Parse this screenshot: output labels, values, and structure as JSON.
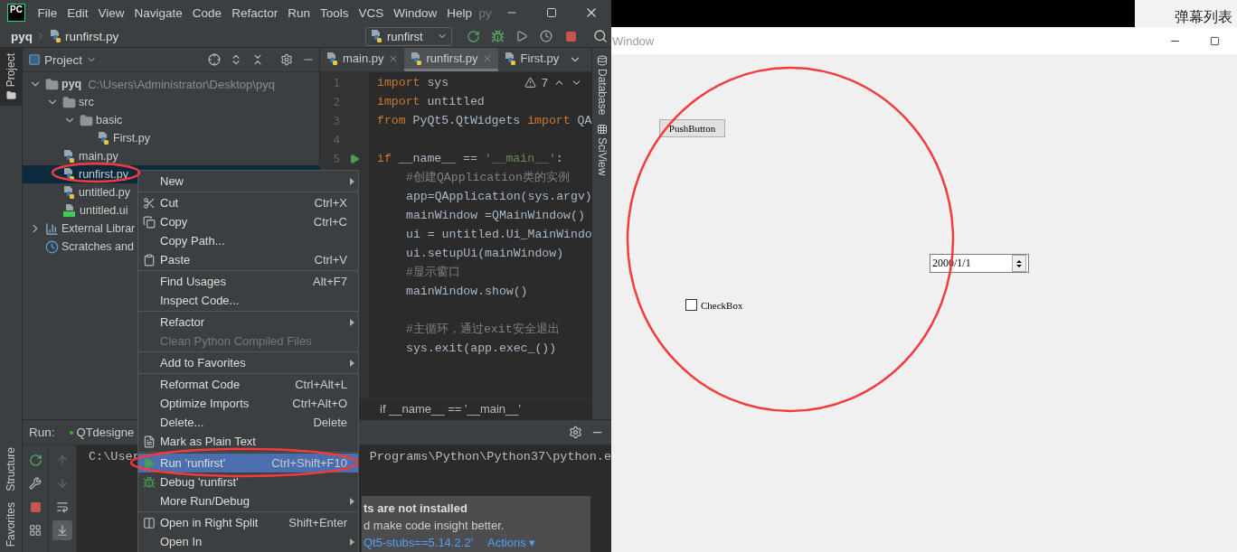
{
  "menubar": {
    "logo": "PC",
    "items": [
      "File",
      "Edit",
      "View",
      "Navigate",
      "Code",
      "Refactor",
      "Run",
      "Tools",
      "VCS",
      "Window",
      "Help"
    ],
    "title_fragment": "py"
  },
  "navbar": {
    "project": "pyq",
    "file": "runfirst.py",
    "run_config": "runfirst"
  },
  "left_stripe": {
    "top": [
      {
        "label": "Project",
        "selected": true
      }
    ],
    "bottom": [
      {
        "label": "Structure",
        "selected": false
      },
      {
        "label": "Favorites",
        "selected": false
      }
    ]
  },
  "project_panel": {
    "title": "Project",
    "tree": [
      {
        "kind": "folder",
        "label": "pyq",
        "path": "C:\\Users\\Administrator\\Desktop\\pyq",
        "expanded": true,
        "selected": false,
        "children": [
          {
            "kind": "folder",
            "label": "src",
            "expanded": true,
            "selected": false,
            "children": [
              {
                "kind": "folder",
                "label": "basic",
                "expanded": true,
                "selected": false,
                "children": [
                  {
                    "kind": "python",
                    "label": "First.py",
                    "selected": false
                  }
                ]
              }
            ]
          },
          {
            "kind": "python",
            "label": "main.py",
            "selected": false
          },
          {
            "kind": "python",
            "label": "runfirst.py",
            "selected": true
          },
          {
            "kind": "python",
            "label": "untitled.py",
            "selected": false
          },
          {
            "kind": "ui",
            "label": "untitled.ui",
            "selected": false
          }
        ]
      },
      {
        "kind": "library",
        "label": "External Librar",
        "expanded": false,
        "selected": false
      },
      {
        "kind": "scratches",
        "label": "Scratches and",
        "selected": false
      }
    ]
  },
  "editor": {
    "tabs": [
      {
        "label": "main.py",
        "selected": false,
        "closable": true
      },
      {
        "label": "runfirst.py",
        "selected": true,
        "closable": true
      },
      {
        "label": "First.py",
        "selected": false,
        "closable": false
      }
    ],
    "warning_count": "7",
    "lines": [
      {
        "kind": "code",
        "number": "1",
        "runnable": false,
        "indented": false,
        "tokens": [
          {
            "kind": "keyword",
            "text": "import"
          },
          {
            "kind": "plain",
            "text": " sys"
          }
        ]
      },
      {
        "kind": "code",
        "number": "2",
        "runnable": false,
        "indented": false,
        "tokens": [
          {
            "kind": "keyword",
            "text": "import"
          },
          {
            "kind": "plain",
            "text": " untitled"
          }
        ]
      },
      {
        "kind": "code",
        "number": "3",
        "runnable": false,
        "indented": false,
        "tokens": [
          {
            "kind": "keyword",
            "text": "from"
          },
          {
            "kind": "plain",
            "text": " PyQt5.QtWidgets "
          },
          {
            "kind": "keyword",
            "text": "import"
          },
          {
            "kind": "plain",
            "text": " QA"
          }
        ]
      },
      {
        "kind": "blank",
        "number": "4",
        "runnable": false
      },
      {
        "kind": "code",
        "number": "5",
        "runnable": true,
        "indented": false,
        "tokens": [
          {
            "kind": "keyword",
            "text": "if"
          },
          {
            "kind": "plain",
            "text": " __name__ == "
          },
          {
            "kind": "string",
            "text": "'__main__'"
          },
          {
            "kind": "plain",
            "text": ":"
          }
        ]
      },
      {
        "kind": "code",
        "indented": true,
        "tokens": [
          {
            "kind": "comment",
            "text": "#创建QApplication类的实例"
          }
        ]
      },
      {
        "kind": "code",
        "indented": true,
        "tokens": [
          {
            "kind": "plain",
            "text": "app=QApplication(sys.argv)"
          }
        ]
      },
      {
        "kind": "code",
        "indented": true,
        "tokens": [
          {
            "kind": "plain",
            "text": "mainWindow =QMainWindow()"
          }
        ]
      },
      {
        "kind": "code",
        "indented": true,
        "tokens": [
          {
            "kind": "plain",
            "text": "ui = untitled.Ui_MainWindo"
          }
        ]
      },
      {
        "kind": "code",
        "indented": true,
        "tokens": [
          {
            "kind": "plain",
            "text": "ui.setupUi(mainWindow)"
          }
        ]
      },
      {
        "kind": "code",
        "indented": true,
        "tokens": [
          {
            "kind": "comment",
            "text": "#显示窗口"
          }
        ]
      },
      {
        "kind": "code",
        "indented": true,
        "tokens": [
          {
            "kind": "plain",
            "text": "mainWindow.show()"
          }
        ]
      },
      {
        "kind": "blank"
      },
      {
        "kind": "code",
        "indented": true,
        "tokens": [
          {
            "kind": "comment",
            "text": "#主循环，通过exit安全退出"
          }
        ]
      },
      {
        "kind": "code",
        "indented": true,
        "tokens": [
          {
            "kind": "plain",
            "text": "sys.exit(app.exec_())"
          }
        ]
      }
    ],
    "breadcrumb": "if __name__ == '__main__'"
  },
  "right_stripe": [
    {
      "label": "Database"
    },
    {
      "label": "SciView"
    }
  ],
  "run_panel": {
    "label": "Run:",
    "tab": "QTdesigne",
    "output": [
      "C:\\User",
      "Programs\\Python\\Python37\\python.e"
    ],
    "notification": {
      "title": "ts are not installed",
      "body": "d make code insight better.",
      "link": "Qt5-stubs==5.14.2.2'",
      "action": "Actions ▾"
    }
  },
  "context_menu": {
    "groups": [
      [
        {
          "label": "New",
          "submenu": true,
          "disabled": false,
          "selected": false
        }
      ],
      [
        {
          "label": "Cut",
          "shortcut": "Ctrl+X",
          "submenu": false,
          "disabled": false,
          "selected": false
        },
        {
          "label": "Copy",
          "shortcut": "Ctrl+C",
          "submenu": false,
          "disabled": false,
          "selected": false
        },
        {
          "label": "Copy Path...",
          "submenu": false,
          "disabled": false,
          "selected": false
        },
        {
          "label": "Paste",
          "shortcut": "Ctrl+V",
          "submenu": false,
          "disabled": false,
          "selected": false
        }
      ],
      [
        {
          "label": "Find Usages",
          "shortcut": "Alt+F7",
          "submenu": false,
          "disabled": false,
          "selected": false
        },
        {
          "label": "Inspect Code...",
          "submenu": false,
          "disabled": false,
          "selected": false
        }
      ],
      [
        {
          "label": "Refactor",
          "submenu": true,
          "disabled": false,
          "selected": false
        },
        {
          "label": "Clean Python Compiled Files",
          "submenu": false,
          "disabled": true,
          "selected": false
        }
      ],
      [
        {
          "label": "Add to Favorites",
          "submenu": true,
          "disabled": false,
          "selected": false
        }
      ],
      [
        {
          "label": "Reformat Code",
          "shortcut": "Ctrl+Alt+L",
          "submenu": false,
          "disabled": false,
          "selected": false
        },
        {
          "label": "Optimize Imports",
          "shortcut": "Ctrl+Alt+O",
          "submenu": false,
          "disabled": false,
          "selected": false
        },
        {
          "label": "Delete...",
          "shortcut": "Delete",
          "submenu": false,
          "disabled": false,
          "selected": false
        },
        {
          "label": "Mark as Plain Text",
          "submenu": false,
          "disabled": false,
          "selected": false
        }
      ],
      [
        {
          "label": "Run 'runfirst'",
          "shortcut": "Ctrl+Shift+F10",
          "submenu": false,
          "disabled": false,
          "selected": true
        },
        {
          "label": "Debug 'runfirst'",
          "submenu": false,
          "disabled": false,
          "selected": false
        },
        {
          "label": "More Run/Debug",
          "submenu": true,
          "disabled": false,
          "selected": false
        }
      ],
      [
        {
          "label": "Open in Right Split",
          "shortcut": "Shift+Enter",
          "submenu": false,
          "disabled": false,
          "selected": false
        },
        {
          "label": "Open In",
          "submenu": true,
          "disabled": false,
          "selected": false
        }
      ]
    ]
  },
  "top_strip": {
    "label": "弹幕列表"
  },
  "qt_window": {
    "title": "Window",
    "button": "PushButton",
    "date": "2000/1/1",
    "checkbox": {
      "label": "CheckBox",
      "checked": false
    }
  }
}
